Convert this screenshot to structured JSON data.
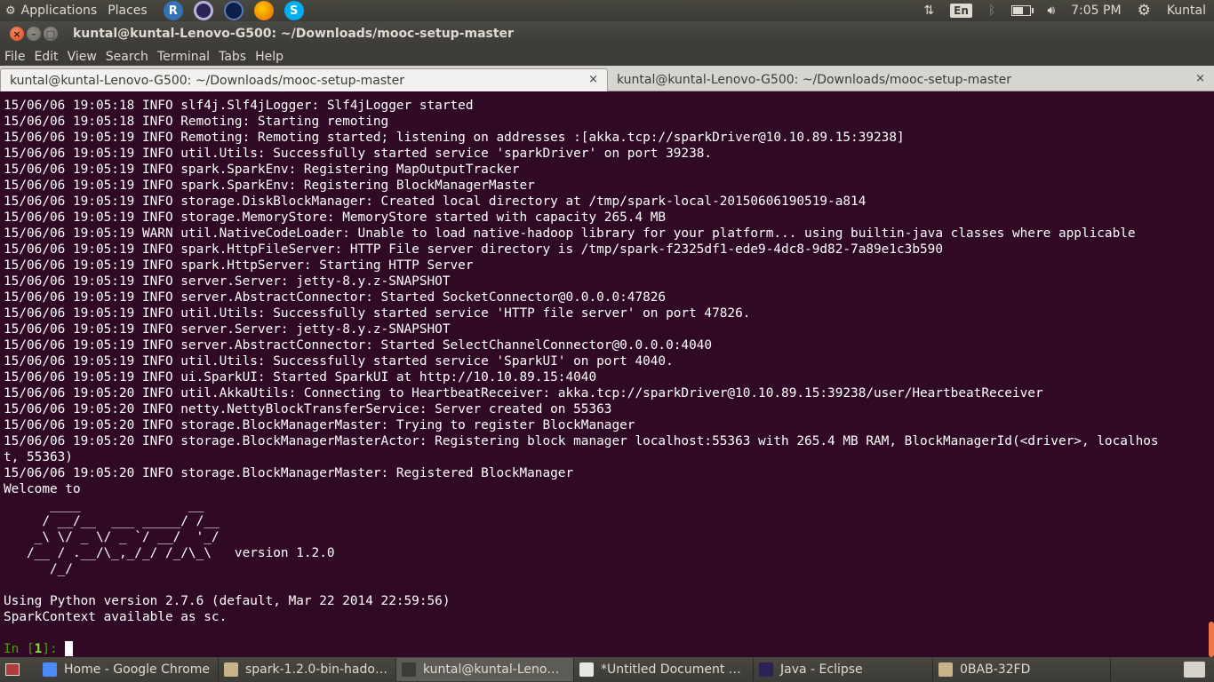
{
  "top_panel": {
    "applications": "Applications",
    "places": "Places",
    "launchers": [
      {
        "name": "rstudio-icon",
        "glyph": "R",
        "color": "#3572b5"
      },
      {
        "name": "eclipse-icon",
        "glyph": "",
        "color": "#2c2255"
      },
      {
        "name": "night-sky-icon",
        "glyph": "",
        "color": "#0b1f4a"
      },
      {
        "name": "firefox-icon",
        "glyph": "",
        "color": "#e66000"
      },
      {
        "name": "skype-icon",
        "glyph": "S",
        "color": "#00aff0"
      }
    ],
    "lang": "En",
    "battery_level": 0.6,
    "time": "7:05 PM",
    "user": "Kuntal"
  },
  "window": {
    "title": "kuntal@kuntal-Lenovo-G500: ~/Downloads/mooc-setup-master",
    "menu": [
      "File",
      "Edit",
      "View",
      "Search",
      "Terminal",
      "Tabs",
      "Help"
    ],
    "tabs": [
      {
        "label": "kuntal@kuntal-Lenovo-G500: ~/Downloads/mooc-setup-master",
        "close": "×"
      },
      {
        "label": "kuntal@kuntal-Lenovo-G500: ~/Downloads/mooc-setup-master",
        "close": "×"
      }
    ]
  },
  "terminal": {
    "lines": [
      "15/06/06 19:05:18 INFO slf4j.Slf4jLogger: Slf4jLogger started",
      "15/06/06 19:05:18 INFO Remoting: Starting remoting",
      "15/06/06 19:05:19 INFO Remoting: Remoting started; listening on addresses :[akka.tcp://sparkDriver@10.10.89.15:39238]",
      "15/06/06 19:05:19 INFO util.Utils: Successfully started service 'sparkDriver' on port 39238.",
      "15/06/06 19:05:19 INFO spark.SparkEnv: Registering MapOutputTracker",
      "15/06/06 19:05:19 INFO spark.SparkEnv: Registering BlockManagerMaster",
      "15/06/06 19:05:19 INFO storage.DiskBlockManager: Created local directory at /tmp/spark-local-20150606190519-a814",
      "15/06/06 19:05:19 INFO storage.MemoryStore: MemoryStore started with capacity 265.4 MB",
      "15/06/06 19:05:19 WARN util.NativeCodeLoader: Unable to load native-hadoop library for your platform... using builtin-java classes where applicable",
      "15/06/06 19:05:19 INFO spark.HttpFileServer: HTTP File server directory is /tmp/spark-f2325df1-ede9-4dc8-9d82-7a89e1c3b590",
      "15/06/06 19:05:19 INFO spark.HttpServer: Starting HTTP Server",
      "15/06/06 19:05:19 INFO server.Server: jetty-8.y.z-SNAPSHOT",
      "15/06/06 19:05:19 INFO server.AbstractConnector: Started SocketConnector@0.0.0.0:47826",
      "15/06/06 19:05:19 INFO util.Utils: Successfully started service 'HTTP file server' on port 47826.",
      "15/06/06 19:05:19 INFO server.Server: jetty-8.y.z-SNAPSHOT",
      "15/06/06 19:05:19 INFO server.AbstractConnector: Started SelectChannelConnector@0.0.0.0:4040",
      "15/06/06 19:05:19 INFO util.Utils: Successfully started service 'SparkUI' on port 4040.",
      "15/06/06 19:05:19 INFO ui.SparkUI: Started SparkUI at http://10.10.89.15:4040",
      "15/06/06 19:05:20 INFO util.AkkaUtils: Connecting to HeartbeatReceiver: akka.tcp://sparkDriver@10.10.89.15:39238/user/HeartbeatReceiver",
      "15/06/06 19:05:20 INFO netty.NettyBlockTransferService: Server created on 55363",
      "15/06/06 19:05:20 INFO storage.BlockManagerMaster: Trying to register BlockManager",
      "15/06/06 19:05:20 INFO storage.BlockManagerMasterActor: Registering block manager localhost:55363 with 265.4 MB RAM, BlockManagerId(<driver>, localhos",
      "t, 55363)",
      "15/06/06 19:05:20 INFO storage.BlockManagerMaster: Registered BlockManager",
      "Welcome to",
      "      ____              __",
      "     / __/__  ___ _____/ /__",
      "    _\\ \\/ _ \\/ _ `/ __/  '_/",
      "   /__ / .__/\\_,_/_/ /_/\\_\\   version 1.2.0",
      "      /_/",
      "",
      "Using Python version 2.7.6 (default, Mar 22 2014 22:59:56)",
      "SparkContext available as sc.",
      ""
    ],
    "prompt_in": "In [",
    "prompt_num": "1",
    "prompt_end": "]: "
  },
  "taskbar": {
    "tasks": [
      {
        "label": "Home - Google Chrome",
        "color": "#4c8bf5"
      },
      {
        "label": "spark-1.2.0-bin-hado…",
        "color": "#c9b38a"
      },
      {
        "label": "kuntal@kuntal-Leno…",
        "color": "#3c3b37"
      },
      {
        "label": "*Untitled Document …",
        "color": "#e8e6e0"
      },
      {
        "label": "Java - Eclipse",
        "color": "#2c2255"
      },
      {
        "label": "0BAB-32FD",
        "color": "#c9b38a"
      }
    ]
  }
}
